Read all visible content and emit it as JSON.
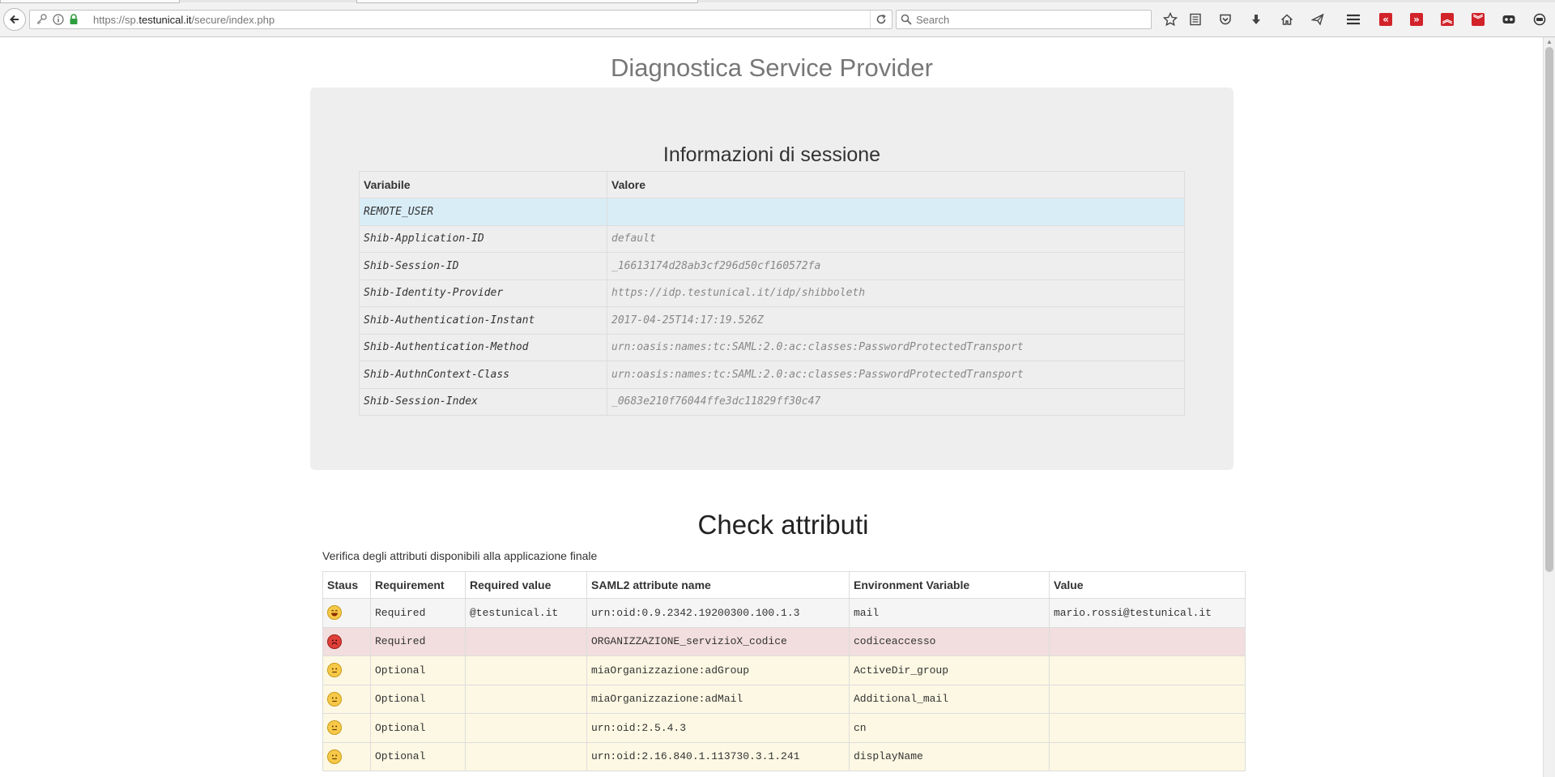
{
  "browser": {
    "url_prefix": "https://sp.",
    "url_host": "testunical.it",
    "url_path": "/secure/index.php",
    "search_placeholder": "Search"
  },
  "page": {
    "title": "Diagnostica Service Provider"
  },
  "session": {
    "heading": "Informazioni di sessione",
    "columns": [
      "Variabile",
      "Valore"
    ],
    "rows": [
      {
        "variable": "REMOTE_USER",
        "value": ""
      },
      {
        "variable": "Shib-Application-ID",
        "value": "default"
      },
      {
        "variable": "Shib-Session-ID",
        "value": "_16613174d28ab3cf296d50cf160572fa"
      },
      {
        "variable": "Shib-Identity-Provider",
        "value": "https://idp.testunical.it/idp/shibboleth"
      },
      {
        "variable": "Shib-Authentication-Instant",
        "value": "2017-04-25T14:17:19.526Z"
      },
      {
        "variable": "Shib-Authentication-Method",
        "value": "urn:oasis:names:tc:SAML:2.0:ac:classes:PasswordProtectedTransport"
      },
      {
        "variable": "Shib-AuthnContext-Class",
        "value": "urn:oasis:names:tc:SAML:2.0:ac:classes:PasswordProtectedTransport"
      },
      {
        "variable": "Shib-Session-Index",
        "value": "_0683e210f76044ffe3dc11829ff30c47"
      }
    ]
  },
  "check": {
    "heading": "Check attributi",
    "subtitle": "Verifica degli attributi disponibili alla applicazione finale",
    "columns": [
      "Staus",
      "Requirement",
      "Required value",
      "SAML2 attribute name",
      "Environment Variable",
      "Value"
    ],
    "rows": [
      {
        "status": "happy-face-icon",
        "requirement": "Required",
        "required_value": "@testunical.it",
        "saml2": "urn:oid:0.9.2342.19200300.100.1.3",
        "env": "mail",
        "value": "mario.rossi@testunical.it"
      },
      {
        "status": "error-face-icon",
        "requirement": "Required",
        "required_value": "",
        "saml2": "ORGANIZZAZIONE_servizioX_codice",
        "env": "codiceaccesso",
        "value": ""
      },
      {
        "status": "neutral-face-icon",
        "requirement": "Optional",
        "required_value": "",
        "saml2": "miaOrganizzazione:adGroup",
        "env": "ActiveDir_group",
        "value": ""
      },
      {
        "status": "neutral-face-icon",
        "requirement": "Optional",
        "required_value": "",
        "saml2": "miaOrganizzazione:adMail",
        "env": "Additional_mail",
        "value": ""
      },
      {
        "status": "neutral-face-icon",
        "requirement": "Optional",
        "required_value": "",
        "saml2": "urn:oid:2.5.4.3",
        "env": "cn",
        "value": ""
      },
      {
        "status": "neutral-face-icon",
        "requirement": "Optional",
        "required_value": "",
        "saml2": "urn:oid:2.16.840.1.113730.3.1.241",
        "env": "displayName",
        "value": ""
      }
    ]
  },
  "colors": {
    "highlight_row": "#d9edf7",
    "error_row": "#f2dede",
    "optional_row": "#fcf8e3",
    "ok_row": "#f5f5f5",
    "toolbar_red": "#d2232a"
  }
}
